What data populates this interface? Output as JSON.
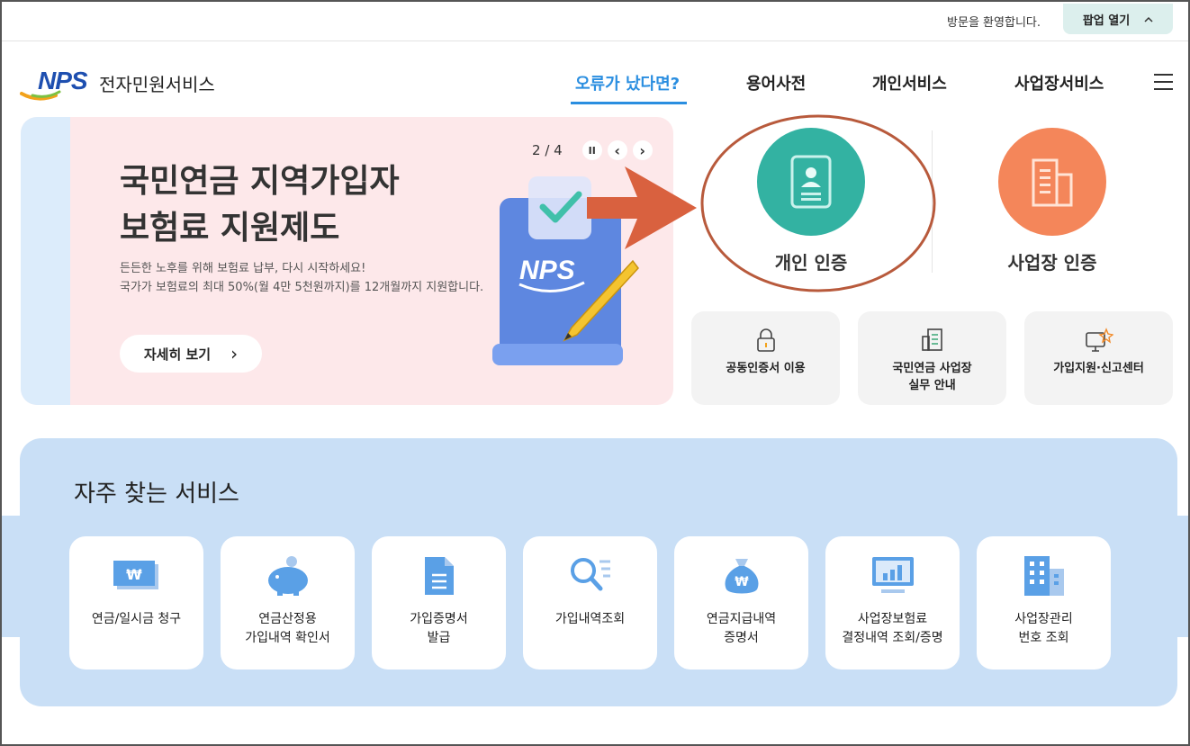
{
  "topbar": {
    "welcome": "방문을 환영합니다.",
    "popup_label": "팝업 열기",
    "popup_icon": "chevron-up-icon"
  },
  "header": {
    "logo_letters": "NPS",
    "logo_text": "전자민원서비스",
    "nav": [
      {
        "label": "오류가 났다면?",
        "active": true
      },
      {
        "label": "용어사전"
      },
      {
        "label": "개인서비스"
      },
      {
        "label": "사업장서비스"
      }
    ]
  },
  "banner": {
    "title_line1": "국민연금 지역가입자",
    "title_line2": "보험료 지원제도",
    "desc_line1": "든든한 노후를 위해 보험료 납부, 다시 시작하세요!",
    "desc_line2": "국가가 보험료의 최대 50%(월 4만 5천원까지)를 12개월까지 지원합니다.",
    "more_label": "자세히 보기",
    "more_arrow": "›",
    "slide_current": "2",
    "slide_total": "4",
    "slide_sep": "/",
    "pause_glyph": "II",
    "prev_glyph": "‹",
    "next_glyph": "›",
    "illustration_text": "NPS",
    "colors": {
      "bg": "#fde8ea",
      "strip": "#dcecfb"
    }
  },
  "certs": [
    {
      "label": "개인 인증",
      "icon": "id-card-icon",
      "color": "#33b2a2"
    },
    {
      "label": "사업장 인증",
      "icon": "building-icon",
      "color": "#f4865a"
    }
  ],
  "quick_links": [
    {
      "label": "공동인증서 이용",
      "icon": "lock-icon"
    },
    {
      "label_line1": "국민연금 사업장",
      "label_line2": "실무 안내",
      "icon": "document-icon"
    },
    {
      "label": "가입지원·신고센터",
      "icon": "monitor-star-icon"
    }
  ],
  "services": {
    "title": "자주 찾는 서비스",
    "items": [
      {
        "line1": "연금/일시금 청구",
        "line2": "",
        "icon": "won-bill-icon"
      },
      {
        "line1": "연금산정용",
        "line2": "가입내역 확인서",
        "icon": "piggy-bank-icon"
      },
      {
        "line1": "가입증명서",
        "line2": "발급",
        "icon": "file-list-icon"
      },
      {
        "line1": "가입내역조회",
        "line2": "",
        "icon": "search-list-icon"
      },
      {
        "line1": "연금지급내역",
        "line2": "증명서",
        "icon": "money-bag-icon"
      },
      {
        "line1": "사업장보험료",
        "line2": "결정내역 조회/증명",
        "icon": "monitor-chart-icon"
      },
      {
        "line1": "사업장관리",
        "line2": "번호 조회",
        "icon": "office-building-icon"
      }
    ],
    "won_symbol": "₩"
  },
  "colors": {
    "accent": "#2a8ee0",
    "panel": "#c9dff6",
    "arrow": "#d9613f",
    "ellipse": "#b85a3c",
    "icon_blue": "#5aa0e6"
  }
}
